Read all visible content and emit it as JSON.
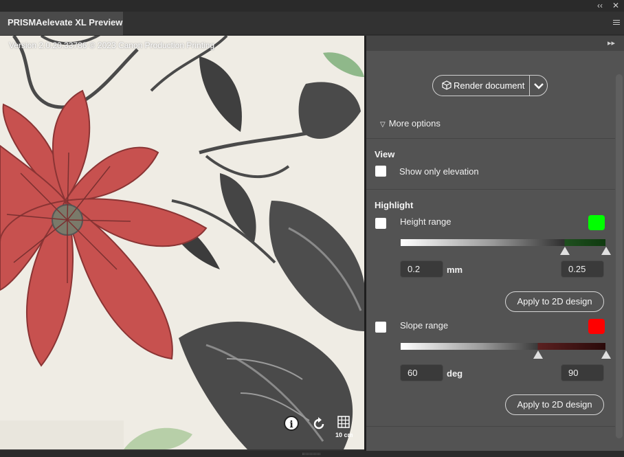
{
  "window": {
    "collapse_glyph": "‹‹",
    "close_glyph": "✕"
  },
  "tab": {
    "title": "PRISMAelevate XL Preview"
  },
  "preview": {
    "version_text": "Version 2.0.20.33786 © 2023 Canon Production Printing",
    "info_glyph": "i",
    "scale_label": "10 cm"
  },
  "side": {
    "expand_glyph": "▸▸",
    "render_label": "Render document",
    "more_options_label": "More options",
    "view": {
      "title": "View",
      "show_only_elevation_label": "Show only elevation",
      "show_only_elevation_checked": false
    },
    "highlight": {
      "title": "Highlight",
      "height_range": {
        "label": "Height range",
        "checked": false,
        "color": "#00ff00",
        "min_value": "0.2",
        "unit": "mm",
        "max_value": "0.25",
        "apply_label": "Apply to 2D design"
      },
      "slope_range": {
        "label": "Slope range",
        "checked": false,
        "color": "#ff0000",
        "min_value": "60",
        "unit": "deg",
        "max_value": "90",
        "apply_label": "Apply to 2D design"
      }
    }
  }
}
